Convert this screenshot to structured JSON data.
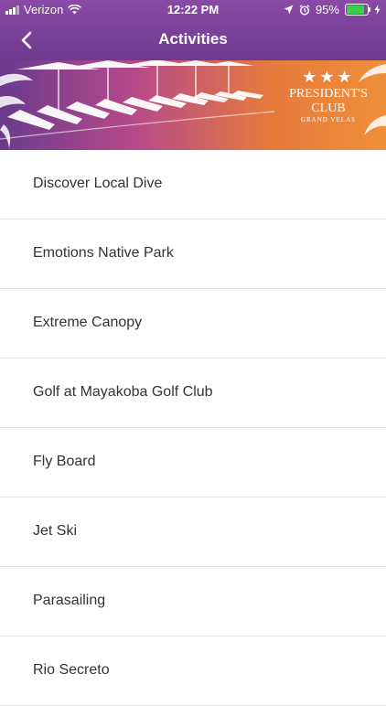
{
  "status_bar": {
    "carrier": "Verizon",
    "time": "12:22 PM",
    "battery_percent": "95%",
    "battery_level": 0.95,
    "icons": [
      "signal-bars-icon",
      "wifi-icon",
      "location-arrow-icon",
      "alarm-icon",
      "battery-icon",
      "charging-bolt-icon"
    ]
  },
  "nav": {
    "title": "Activities",
    "back_icon": "chevron-left-icon"
  },
  "banner": {
    "logo_stars": "★★★",
    "logo_line1": "PRESIDENT'S",
    "logo_line2": "CLUB",
    "logo_sub": "GRAND VELAS",
    "colors": {
      "start": "#6a3a8c",
      "mid": "#b64a8a",
      "end": "#ef8f3a"
    }
  },
  "activities": [
    {
      "label": "Discover Local Dive"
    },
    {
      "label": "Emotions Native Park"
    },
    {
      "label": "Extreme Canopy"
    },
    {
      "label": "Golf at Mayakoba Golf Club"
    },
    {
      "label": "Fly Board"
    },
    {
      "label": "Jet Ski"
    },
    {
      "label": "Parasailing"
    },
    {
      "label": "Rio Secreto"
    }
  ],
  "theme": {
    "header": "#7a3f99",
    "text": "#333333",
    "divider": "#e2e2e2"
  }
}
